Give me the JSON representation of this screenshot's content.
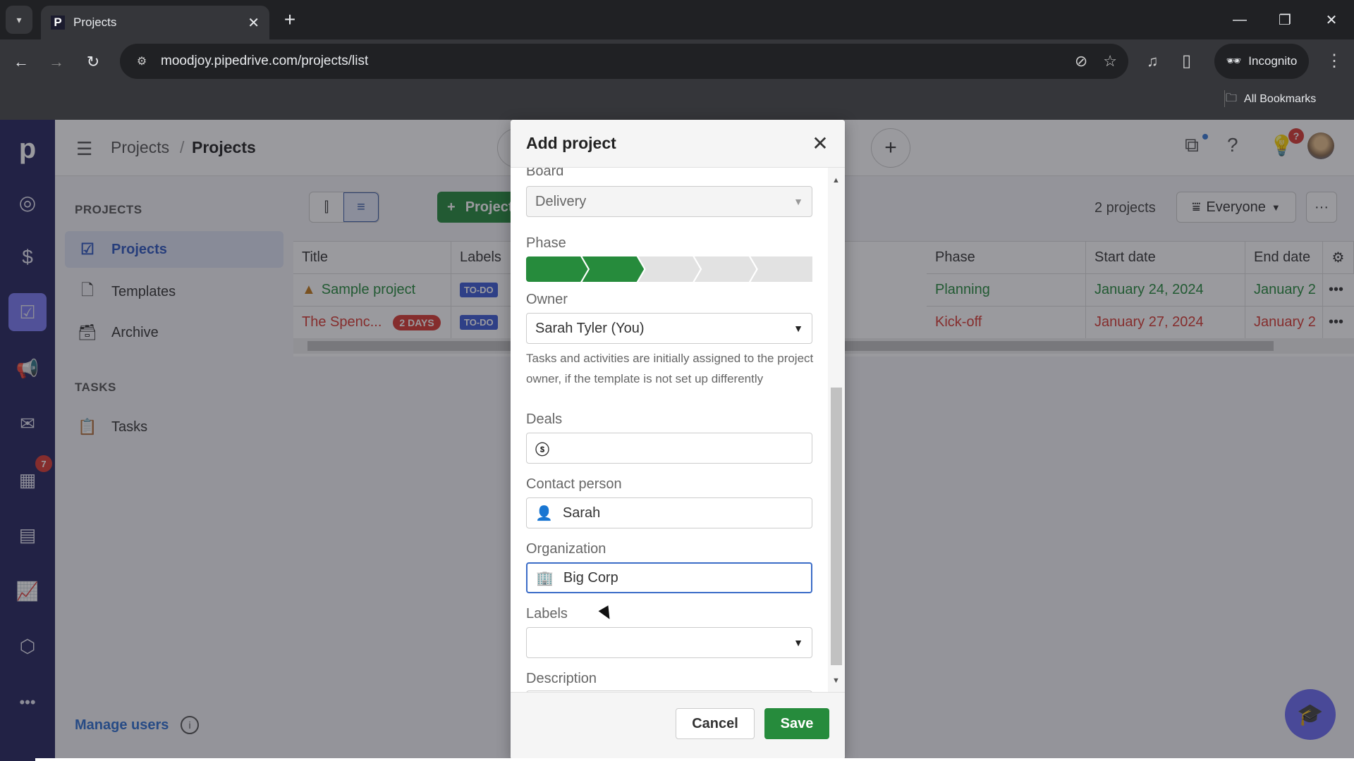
{
  "browser": {
    "tab_title": "Projects",
    "favicon": "P",
    "url": "moodjoy.pipedrive.com/projects/list",
    "incognito_label": "Incognito",
    "bookmarks_label": "All Bookmarks"
  },
  "header": {
    "breadcrumb": [
      "Projects",
      "Projects"
    ],
    "breadcrumb_sep": "/",
    "notification_badge": "?"
  },
  "rail": {
    "logo": "p",
    "items": [
      "leads-icon",
      "deals-icon",
      "projects-icon",
      "campaigns-icon",
      "mail-icon",
      "activities-icon",
      "contacts-icon",
      "insights-icon",
      "products-icon",
      "more-icon"
    ],
    "active": "projects-icon",
    "activities_badge": "7"
  },
  "sidenav": {
    "projects_section": "PROJECTS",
    "items": [
      {
        "label": "Projects",
        "icon": "clipboard-check-icon",
        "active": true
      },
      {
        "label": "Templates",
        "icon": "template-icon",
        "active": false
      },
      {
        "label": "Archive",
        "icon": "archive-icon",
        "active": false
      }
    ],
    "tasks_section": "TASKS",
    "tasks_items": [
      {
        "label": "Tasks",
        "icon": "clipboard-icon"
      }
    ],
    "manage_users": "Manage users"
  },
  "toolbar": {
    "add_project_label": "Project",
    "count": "2 projects",
    "filter_label": "Everyone",
    "more_label": "···"
  },
  "table": {
    "columns": [
      "Title",
      "Labels",
      "Phase",
      "Start date",
      "End date"
    ],
    "rows": [
      {
        "title": "Sample project",
        "badge": "",
        "label": "TO-DO",
        "phase": "Planning",
        "start": "January 24, 2024",
        "end": "January 2",
        "status": "green"
      },
      {
        "title": "The Spenc...",
        "badge": "2 DAYS",
        "label": "TO-DO",
        "phase": "Kick-off",
        "start": "January 27, 2024",
        "end": "January 2",
        "status": "red"
      }
    ]
  },
  "modal": {
    "title": "Add project",
    "board_label": "Board",
    "board_value": "Delivery",
    "phase_label": "Phase",
    "phase_total": 5,
    "phase_completed": 2,
    "owner_label": "Owner",
    "owner_value": "Sarah Tyler (You)",
    "owner_help": "Tasks and activities are initially assigned to the project owner, if the template is not set up differently",
    "deals_label": "Deals",
    "deals_value": "",
    "contact_label": "Contact person",
    "contact_value": "Sarah",
    "org_label": "Organization",
    "org_value": "Big Corp",
    "labels_label": "Labels",
    "labels_value": "",
    "description_label": "Description",
    "description_value": "",
    "cancel_label": "Cancel",
    "save_label": "Save"
  },
  "colors": {
    "brand_green": "#268b3c",
    "rail_bg": "#26265e",
    "accent_blue": "#3c5bd6",
    "danger_red": "#d93a32"
  }
}
